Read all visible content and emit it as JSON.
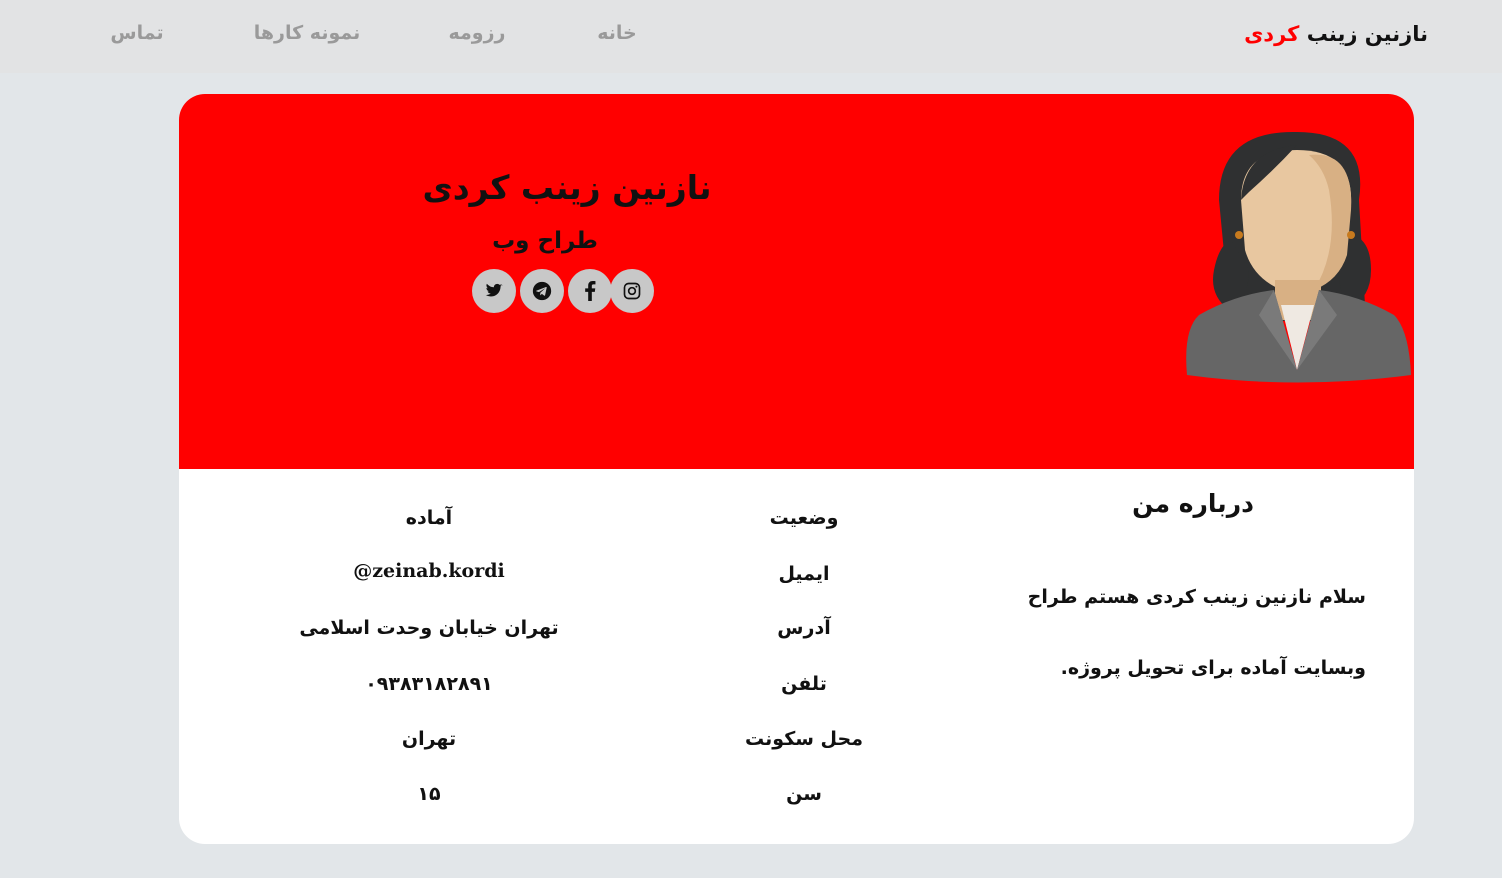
{
  "header": {
    "brand_main": "نازنین زینب",
    "brand_accent": "کردی",
    "nav": [
      "خانه",
      "رزومه",
      "نمونه کارها",
      "تماس"
    ]
  },
  "hero": {
    "name": "نازنین زینب کردی",
    "role": "طراح وب",
    "socials": [
      "twitter-icon",
      "telegram-icon",
      "facebook-icon",
      "instagram-icon"
    ]
  },
  "about": {
    "title": "درباره من",
    "lines": [
      "سلام نازنین زینب کردی هستم طراح",
      "وبسایت آماده برای تحویل پروژه."
    ]
  },
  "info": [
    {
      "label": "وضعیت",
      "value": "آماده"
    },
    {
      "label": "ایمیل",
      "value": "@zeinab.kordi"
    },
    {
      "label": "آدرس",
      "value": "تهران خیابان وحدت اسلامی"
    },
    {
      "label": "تلفن",
      "value": "۰۹۳۸۳۱۸۲۸۹۱"
    },
    {
      "label": "محل سکونت",
      "value": "تهران"
    },
    {
      "label": "سن",
      "value": "۱۵"
    }
  ],
  "colors": {
    "accent": "#ff0000",
    "nav_text": "#9a9a9a",
    "header_bg": "#e2e3e4",
    "page_bg": "#e2e6e9"
  }
}
